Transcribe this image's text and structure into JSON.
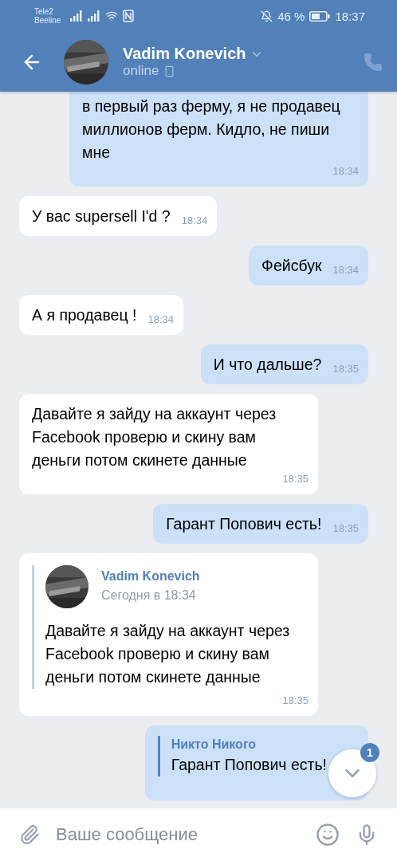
{
  "status_bar": {
    "carriers": [
      "Tele2",
      "Beeline"
    ],
    "battery": "46 %",
    "time": "18:37"
  },
  "header": {
    "name": "Vadim Konevich",
    "status": "online"
  },
  "messages": [
    {
      "kind": "text",
      "outgoing": true,
      "cut_top": true,
      "text": "в первый раз ферму, я не продавец миллионов ферм. Кидло, не пиши мне",
      "time": "18:34"
    },
    {
      "kind": "text",
      "outgoing": false,
      "text": "У вас supersell I'd ?",
      "time": "18:34"
    },
    {
      "kind": "text",
      "outgoing": true,
      "text": "Фейсбук",
      "time": "18:34"
    },
    {
      "kind": "text",
      "outgoing": false,
      "text": "А я продавец !",
      "time": "18:34"
    },
    {
      "kind": "text",
      "outgoing": true,
      "text": "И что дальше?",
      "time": "18:35"
    },
    {
      "kind": "text",
      "outgoing": false,
      "text": "Давайте я зайду на аккаунт через Facebook проверю и скину вам деньги потом скинете данные",
      "time": "18:35"
    },
    {
      "kind": "text",
      "outgoing": true,
      "text": "Гарант Попович есть!",
      "time": "18:35"
    },
    {
      "kind": "forward",
      "outgoing": false,
      "author": "Vadim Konevich",
      "date": "Сегодня в 18:34",
      "text": "Давайте я зайду на аккаунт через Facebook проверю и скину вам деньги потом скинете данные",
      "time": "18:35"
    },
    {
      "kind": "reply",
      "outgoing": true,
      "author": "Никто Никого",
      "text": "Гарант Попович есть!"
    }
  ],
  "scroll_button": {
    "badge": "1"
  },
  "composer": {
    "placeholder": "Ваше сообщение"
  }
}
